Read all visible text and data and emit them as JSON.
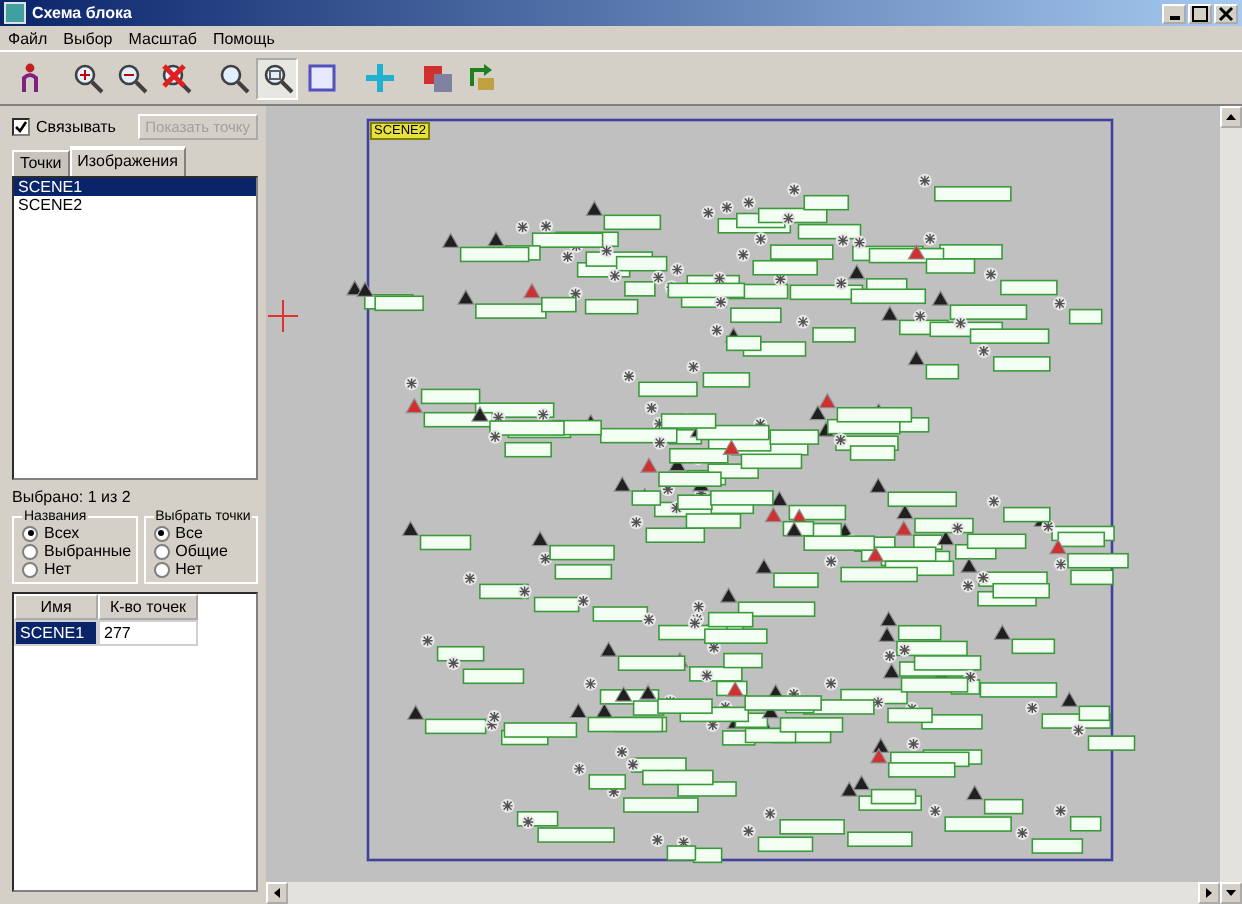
{
  "window": {
    "title": "Схема блока"
  },
  "menu": [
    "Файл",
    "Выбор",
    "Масштаб",
    "Помощь"
  ],
  "toolbar": [
    {
      "pressed": false
    },
    {
      "pressed": false
    },
    {
      "pressed": false
    },
    {
      "pressed": false
    },
    {
      "pressed": false
    },
    {
      "pressed": true
    },
    {
      "pressed": false
    },
    {
      "pressed": false
    },
    {
      "pressed": false
    },
    {
      "pressed": false
    }
  ],
  "link_checkbox": {
    "label": "Связывать",
    "checked": true
  },
  "show_point_button": {
    "label": "Показать точку",
    "disabled": true
  },
  "tabs": [
    {
      "label": "Точки",
      "selected": false
    },
    {
      "label": "Изображения",
      "selected": true
    }
  ],
  "images": [
    {
      "name": "SCENE1",
      "selected": true
    },
    {
      "name": "SCENE2",
      "selected": false
    }
  ],
  "selection_status": "Выбрано: 1 из 2",
  "groups": [
    {
      "title": "Названия",
      "options": [
        {
          "label": "Всех",
          "selected": true
        },
        {
          "label": "Выбранные",
          "selected": false
        },
        {
          "label": "Нет",
          "selected": false
        }
      ]
    },
    {
      "title": "Выбрать точки",
      "options": [
        {
          "label": "Все",
          "selected": true
        },
        {
          "label": "Общие",
          "selected": false
        },
        {
          "label": "Нет",
          "selected": false
        }
      ]
    }
  ],
  "table": {
    "columns": [
      "Имя",
      "К-во точек"
    ],
    "rows": [
      {
        "cells": [
          "SCENE1",
          "277"
        ],
        "selected": true
      }
    ]
  },
  "canvas": {
    "scene_tag": "SCENE2"
  }
}
